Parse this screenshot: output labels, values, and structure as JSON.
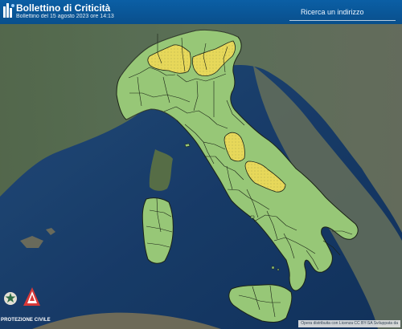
{
  "header": {
    "title": "Bollettino di Criticità",
    "subtitle": "Bollettino del 15 agosto 2023 ore 14:13",
    "search_label": "Ricerca un indirizzo"
  },
  "map": {
    "criticality_colors": {
      "ordinary_green": "#97c777",
      "yellow_alert": "#e7d85a"
    }
  },
  "branding": {
    "name": "PROTEZIONE CIVILE"
  },
  "attribution": "Opera distribuita con Licenza CC BY-SA Sviluppata da"
}
